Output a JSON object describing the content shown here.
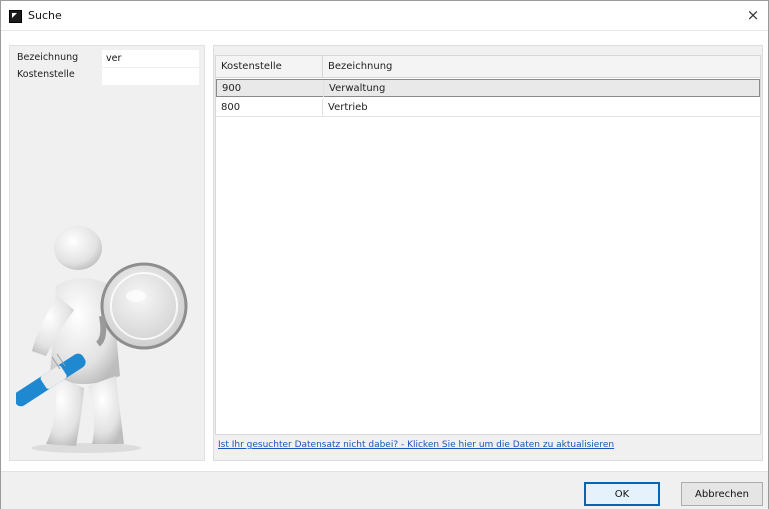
{
  "window": {
    "title": "Suche",
    "close_symbol": "×",
    "icon": "app-icon"
  },
  "filters": {
    "bezeichnung_label": "Bezeichnung",
    "bezeichnung_value": "ver",
    "kostenstelle_label": "Kostenstelle",
    "kostenstelle_value": ""
  },
  "illustration": {
    "icon": "person-with-magnifier-illustration"
  },
  "grid": {
    "columns": [
      "Kostenstelle",
      "Bezeichnung"
    ],
    "rows": [
      {
        "kostenstelle": "900",
        "bezeichnung": "Verwaltung",
        "selected": true
      },
      {
        "kostenstelle": "800",
        "bezeichnung": "Vertrieb",
        "selected": false
      }
    ]
  },
  "refresh_link": "Ist Ihr gesuchter Datensatz nicht dabei? - Klicken Sie hier um die Daten zu aktualisieren",
  "buttons": {
    "ok": "OK",
    "cancel": "Abbrechen"
  },
  "colors": {
    "accent": "#0a64b4",
    "link": "#1a56b8",
    "magnifier_handle": "#1e88d0"
  }
}
